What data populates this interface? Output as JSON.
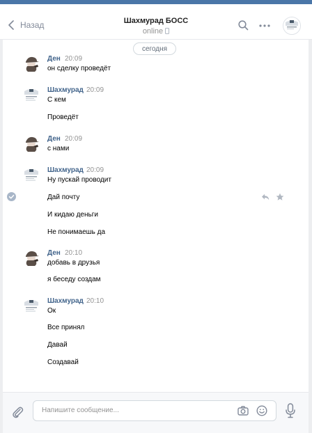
{
  "header": {
    "back_label": "Назад",
    "title": "Шахмурад БОСС",
    "status": "online"
  },
  "chat": {
    "date_divider": "сегодня",
    "cutoff_text": "...",
    "messages": [
      {
        "author": "Ден",
        "time": "20:09",
        "lines": [
          "он сделку проведёт"
        ]
      },
      {
        "author": "Шахмурад",
        "time": "20:09",
        "lines": [
          "С кем",
          "Проведёт"
        ]
      },
      {
        "author": "Ден",
        "time": "20:09",
        "lines": [
          "с нами"
        ]
      },
      {
        "author": "Шахмурад",
        "time": "20:09",
        "lines": [
          "Ну пускай проводит",
          "Дай почту",
          "И кидаю деньги",
          "Не понимаешь да"
        ]
      },
      {
        "author": "Ден",
        "time": "20:10",
        "lines": [
          "добавь в друзья",
          "я беседу создам"
        ]
      },
      {
        "author": "Шахмурад",
        "time": "20:10",
        "lines": [
          "Ок",
          "Все принял",
          "Давай",
          "Создавай"
        ]
      }
    ]
  },
  "composer": {
    "placeholder": "Напишите сообщение..."
  },
  "colors": {
    "accent": "#4a76a8",
    "author": "#42648b",
    "muted": "#939393"
  },
  "icons": [
    "chevron-left-icon",
    "phone-icon",
    "search-icon",
    "more-icon",
    "checkmark-icon",
    "reply-icon",
    "star-icon",
    "paperclip-icon",
    "camera-icon",
    "smile-icon",
    "microphone-icon"
  ]
}
